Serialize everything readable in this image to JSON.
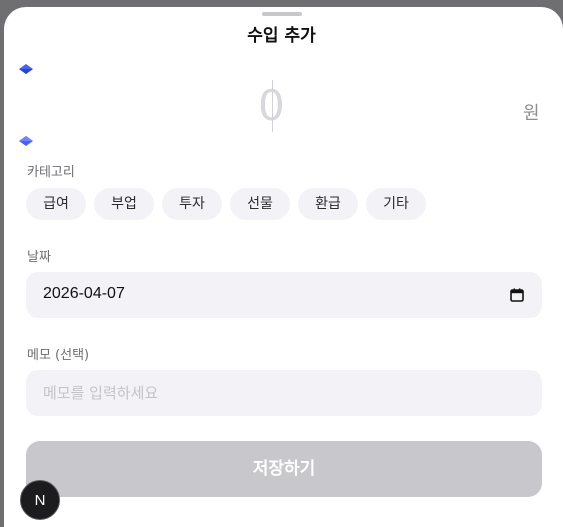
{
  "sheet": {
    "title": "수입 추가"
  },
  "amount": {
    "value": "0",
    "unit": "원"
  },
  "category": {
    "label": "카테고리",
    "chips": [
      "급여",
      "부업",
      "투자",
      "선물",
      "환급",
      "기타"
    ]
  },
  "date": {
    "label": "날짜",
    "value": "2026-04-07"
  },
  "memo": {
    "label": "메모 (선택)",
    "placeholder": "메모를 입력하세요",
    "value": ""
  },
  "save_button": {
    "label": "저장하기"
  },
  "badge": {
    "label": "N"
  },
  "colors": {
    "stepper": "#4a63e8",
    "save_disabled": "#c7c7cc",
    "chip_bg": "#f2f2f7"
  }
}
